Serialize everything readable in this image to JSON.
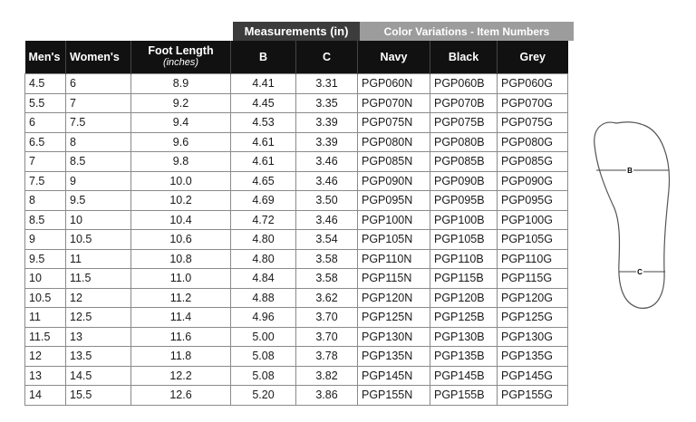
{
  "groups": {
    "measurements": "Measurements (in)",
    "colors": "Color Variations - Item Numbers"
  },
  "headers": {
    "mens": "Men's",
    "womens": "Women's",
    "foot_length": "Foot Length",
    "foot_length_unit": "(inches)",
    "b": "B",
    "c": "C",
    "navy": "Navy",
    "black": "Black",
    "grey": "Grey"
  },
  "rows": [
    {
      "mens": "4.5",
      "womens": "6",
      "foot": "8.9",
      "b": "4.41",
      "c": "3.31",
      "navy": "PGP060N",
      "black": "PGP060B",
      "grey": "PGP060G"
    },
    {
      "mens": "5.5",
      "womens": "7",
      "foot": "9.2",
      "b": "4.45",
      "c": "3.35",
      "navy": "PGP070N",
      "black": "PGP070B",
      "grey": "PGP070G"
    },
    {
      "mens": "6",
      "womens": "7.5",
      "foot": "9.4",
      "b": "4.53",
      "c": "3.39",
      "navy": "PGP075N",
      "black": "PGP075B",
      "grey": "PGP075G"
    },
    {
      "mens": "6.5",
      "womens": "8",
      "foot": "9.6",
      "b": "4.61",
      "c": "3.39",
      "navy": "PGP080N",
      "black": "PGP080B",
      "grey": "PGP080G"
    },
    {
      "mens": "7",
      "womens": "8.5",
      "foot": "9.8",
      "b": "4.61",
      "c": "3.46",
      "navy": "PGP085N",
      "black": "PGP085B",
      "grey": "PGP085G"
    },
    {
      "mens": "7.5",
      "womens": "9",
      "foot": "10.0",
      "b": "4.65",
      "c": "3.46",
      "navy": "PGP090N",
      "black": "PGP090B",
      "grey": "PGP090G"
    },
    {
      "mens": "8",
      "womens": "9.5",
      "foot": "10.2",
      "b": "4.69",
      "c": "3.50",
      "navy": "PGP095N",
      "black": "PGP095B",
      "grey": "PGP095G"
    },
    {
      "mens": "8.5",
      "womens": "10",
      "foot": "10.4",
      "b": "4.72",
      "c": "3.46",
      "navy": "PGP100N",
      "black": "PGP100B",
      "grey": "PGP100G"
    },
    {
      "mens": "9",
      "womens": "10.5",
      "foot": "10.6",
      "b": "4.80",
      "c": "3.54",
      "navy": "PGP105N",
      "black": "PGP105B",
      "grey": "PGP105G"
    },
    {
      "mens": "9.5",
      "womens": "11",
      "foot": "10.8",
      "b": "4.80",
      "c": "3.58",
      "navy": "PGP110N",
      "black": "PGP110B",
      "grey": "PGP110G"
    },
    {
      "mens": "10",
      "womens": "11.5",
      "foot": "11.0",
      "b": "4.84",
      "c": "3.58",
      "navy": "PGP115N",
      "black": "PGP115B",
      "grey": "PGP115G"
    },
    {
      "mens": "10.5",
      "womens": "12",
      "foot": "11.2",
      "b": "4.88",
      "c": "3.62",
      "navy": "PGP120N",
      "black": "PGP120B",
      "grey": "PGP120G"
    },
    {
      "mens": "11",
      "womens": "12.5",
      "foot": "11.4",
      "b": "4.96",
      "c": "3.70",
      "navy": "PGP125N",
      "black": "PGP125B",
      "grey": "PGP125G"
    },
    {
      "mens": "11.5",
      "womens": "13",
      "foot": "11.6",
      "b": "5.00",
      "c": "3.70",
      "navy": "PGP130N",
      "black": "PGP130B",
      "grey": "PGP130G"
    },
    {
      "mens": "12",
      "womens": "13.5",
      "foot": "11.8",
      "b": "5.08",
      "c": "3.78",
      "navy": "PGP135N",
      "black": "PGP135B",
      "grey": "PGP135G"
    },
    {
      "mens": "13",
      "womens": "14.5",
      "foot": "12.2",
      "b": "5.08",
      "c": "3.82",
      "navy": "PGP145N",
      "black": "PGP145B",
      "grey": "PGP145G"
    },
    {
      "mens": "14",
      "womens": "15.5",
      "foot": "12.6",
      "b": "5.20",
      "c": "3.86",
      "navy": "PGP155N",
      "black": "PGP155B",
      "grey": "PGP155G"
    }
  ],
  "diagram": {
    "label_b": "B",
    "label_c": "C"
  },
  "colors": {
    "header_bg": "#111111",
    "measurements_bg": "#3c3c3c",
    "colors_bg": "#9c9c9c"
  }
}
